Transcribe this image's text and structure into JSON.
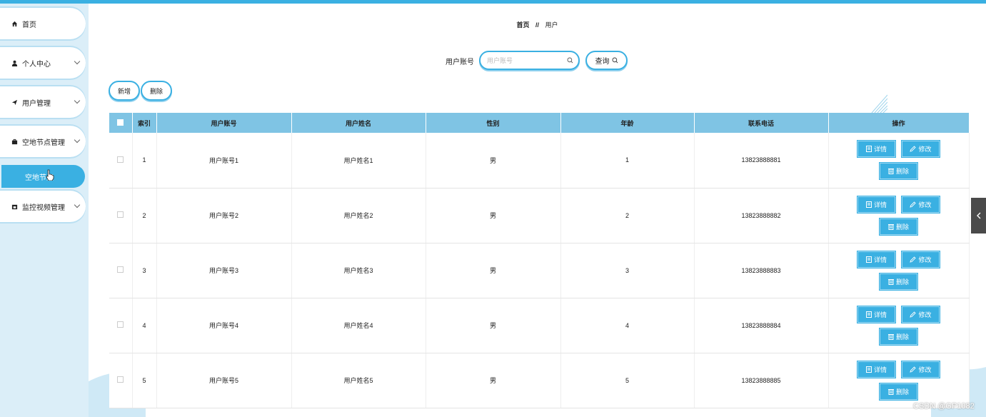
{
  "sidebar": {
    "items": [
      {
        "label": "首页",
        "icon": "home-icon"
      },
      {
        "label": "个人中心",
        "icon": "user-icon"
      },
      {
        "label": "用户管理",
        "icon": "send-icon"
      },
      {
        "label": "空地节点管理",
        "icon": "briefcase-icon"
      },
      {
        "label": "监控视频管理",
        "icon": "calendar-icon"
      }
    ],
    "active_sub": "空地节点"
  },
  "breadcrumb": {
    "home": "首页",
    "sep": "//",
    "current": "用户"
  },
  "search": {
    "label": "用户账号",
    "placeholder": "用户账号",
    "query_label": "查询"
  },
  "actions": {
    "add_label": "新增",
    "delete_label": "删除"
  },
  "table": {
    "headers": [
      "索引",
      "用户账号",
      "用户姓名",
      "性别",
      "年龄",
      "联系电话",
      "操作"
    ],
    "rows": [
      {
        "index": "1",
        "account": "用户账号1",
        "name": "用户姓名1",
        "gender": "男",
        "age": "1",
        "phone": "13823888881"
      },
      {
        "index": "2",
        "account": "用户账号2",
        "name": "用户姓名2",
        "gender": "男",
        "age": "2",
        "phone": "13823888882"
      },
      {
        "index": "3",
        "account": "用户账号3",
        "name": "用户姓名3",
        "gender": "男",
        "age": "3",
        "phone": "13823888883"
      },
      {
        "index": "4",
        "account": "用户账号4",
        "name": "用户姓名4",
        "gender": "男",
        "age": "4",
        "phone": "13823888884"
      },
      {
        "index": "5",
        "account": "用户账号5",
        "name": "用户姓名5",
        "gender": "男",
        "age": "5",
        "phone": "13823888885"
      }
    ],
    "op_labels": {
      "detail": "详情",
      "edit": "修改",
      "delete": "删除"
    }
  },
  "watermark": "CSDN @GP1082",
  "colors": {
    "accent": "#3ab0e2",
    "header_bg": "#7fc4e4",
    "sidebar_bg": "#dbeef8"
  }
}
